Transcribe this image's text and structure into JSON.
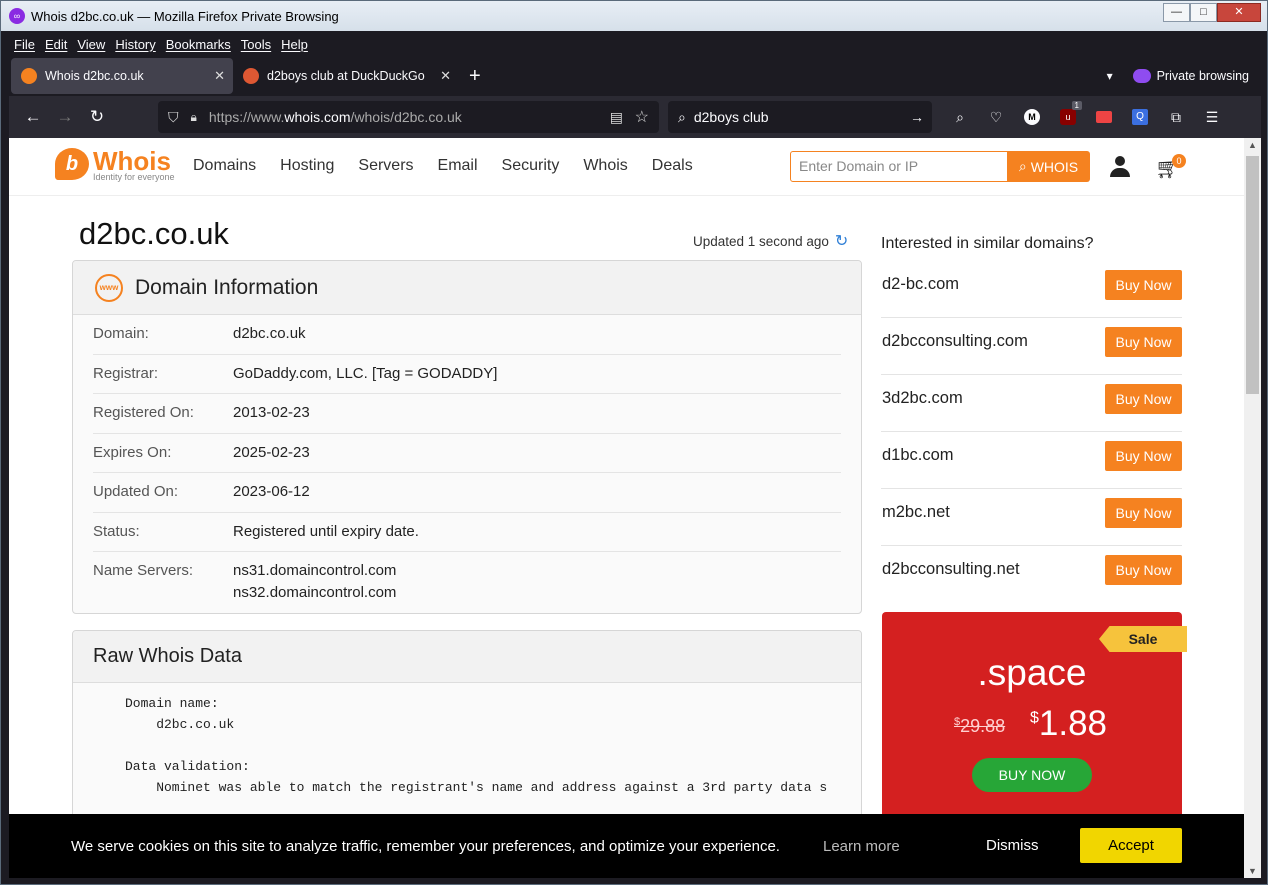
{
  "window": {
    "title": "Whois d2bc.co.uk — Mozilla Firefox Private Browsing",
    "controls": {
      "minimize": "—",
      "maximize": "□",
      "close": "✕"
    }
  },
  "menubar": [
    "File",
    "Edit",
    "View",
    "History",
    "Bookmarks",
    "Tools",
    "Help"
  ],
  "tabs": [
    {
      "label": "Whois d2bc.co.uk",
      "active": true,
      "icon": "whois-favicon",
      "color": "#f58220"
    },
    {
      "label": "d2boys club at DuckDuckGo",
      "active": false,
      "icon": "duckduckgo-favicon",
      "color": "#de5833"
    }
  ],
  "tab_close": "✕",
  "new_tab": "+",
  "private_browsing_label": "Private browsing",
  "url": {
    "prefix": "https://www.",
    "domain": "whois.com",
    "path": "/whois/d2bc.co.uk"
  },
  "search_query": "d2boys club",
  "toolbar_badge": "1",
  "site": {
    "logo_word": "Whois",
    "logo_tagline": "Identity for everyone",
    "nav": [
      "Domains",
      "Hosting",
      "Servers",
      "Email",
      "Security",
      "Whois",
      "Deals"
    ],
    "search_placeholder": "Enter Domain or IP",
    "search_button": "WHOIS",
    "cart_count": "0",
    "accent": "#f58220"
  },
  "domain_title": "d2bc.co.uk",
  "updated_text": "Updated 1 second ago",
  "domain_info": {
    "heading": "Domain Information",
    "www_icon_text": "www",
    "rows": [
      {
        "key": "Domain:",
        "value": "d2bc.co.uk"
      },
      {
        "key": "Registrar:",
        "value": "GoDaddy.com, LLC. [Tag = GODADDY]"
      },
      {
        "key": "Registered On:",
        "value": "2013-02-23"
      },
      {
        "key": "Expires On:",
        "value": "2025-02-23"
      },
      {
        "key": "Updated On:",
        "value": "2023-06-12"
      },
      {
        "key": "Status:",
        "value": "Registered until expiry date."
      },
      {
        "key": "Name Servers:",
        "value": "ns31.domaincontrol.com",
        "value2": "ns32.domaincontrol.com"
      }
    ]
  },
  "raw_whois": {
    "heading": "Raw Whois Data",
    "lines": [
      "Domain name:",
      "    d2bc.co.uk",
      "",
      "Data validation:",
      "    Nominet was able to match the registrant's name and address against a 3rd party data s"
    ]
  },
  "similar": {
    "title": "Interested in similar domains?",
    "buy_label": "Buy Now",
    "domains": [
      "d2-bc.com",
      "d2bcconsulting.com",
      "3d2bc.com",
      "d1bc.com",
      "m2bc.net",
      "d2bcconsulting.net"
    ]
  },
  "promo": {
    "badge": "Sale",
    "tld": ".space",
    "old_currency": "$",
    "old_price": "29.88",
    "new_currency": "$",
    "new_price": "1.88",
    "button": "BUY NOW",
    "color": "#d42020"
  },
  "cookie": {
    "message": "We serve cookies on this site to analyze traffic, remember your preferences, and optimize your experience.",
    "learn_more": "Learn more",
    "dismiss": "Dismiss",
    "accept": "Accept"
  }
}
